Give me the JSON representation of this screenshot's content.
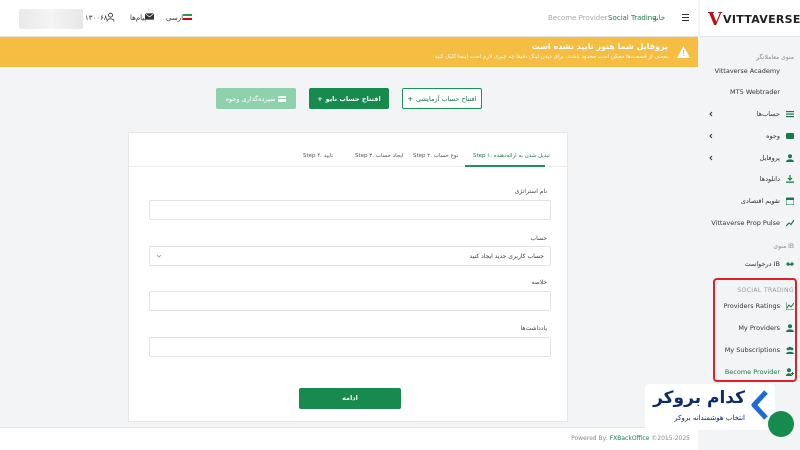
{
  "topbar": {
    "account_number": "۱۳۰۰۶۸",
    "messages_label": "پیام‌ها",
    "language_label": "فارسی",
    "breadcrumb": {
      "home": "خانه",
      "social_trading": "Social Trading",
      "current": "Become Provider"
    }
  },
  "brand": {
    "logo_text": "VITTAVERSE",
    "logo_mark": "V"
  },
  "banner": {
    "title": "پروفایل شما هنوز تایید نشده است",
    "subtitle": "بعضی از قسمت‌ها ممکن است محدود باشند. برای دیدن لینک دقیقا چه چیزی لازم است اینجا کلیک کنید"
  },
  "actions": {
    "demo_account": "افتتاح حساب آزمایشی",
    "real_account": "افتتاح حساب نایو",
    "deposit": "سپرده‌گذاری وجوه"
  },
  "form": {
    "tabs": [
      "Step ۱. تبدیل شدن به ارائه‌دهنده",
      "Step ۲. نوع حساب",
      "Step ۳. ایجاد حساب",
      "Step ۴. تایید"
    ],
    "active_tab": 0,
    "fields": {
      "strategy_name": {
        "label": "نام استراتژی",
        "value": ""
      },
      "account": {
        "label": "حساب",
        "value": "حساب کاربری جدید ایجاد کنید"
      },
      "summary": {
        "label": "خلاصه",
        "value": ""
      },
      "notes": {
        "label": "یادداشت‌ها",
        "value": ""
      }
    },
    "continue_label": "ادامه"
  },
  "sidebar": {
    "main_menu_heading": "منوی معاملاتگر",
    "items": [
      {
        "label": "Vittaverse Academy",
        "icon": "academy-icon",
        "chevron": false
      },
      {
        "label": "MT5 Webtrader",
        "icon": "",
        "chevron": false
      },
      {
        "label": "حساب‌ها",
        "icon": "list-icon",
        "chevron": true
      },
      {
        "label": "وجوه",
        "icon": "wallet-icon",
        "chevron": true
      },
      {
        "label": "پروفایل",
        "icon": "user-icon",
        "chevron": true
      },
      {
        "label": "دانلودها",
        "icon": "download-icon",
        "chevron": false
      },
      {
        "label": "تقویم اقتصادی",
        "icon": "calendar-icon",
        "chevron": false
      },
      {
        "label": "Vittaverse Prop Pulse",
        "icon": "chart-icon",
        "chevron": false
      }
    ],
    "ib_heading": "منوی IB",
    "ib_items": [
      {
        "label": "درخواست IB",
        "icon": "handshake-icon"
      }
    ],
    "social_heading": "SOCIAL TRADING",
    "social_items": [
      {
        "label": "Providers Ratings",
        "icon": "ratings-icon"
      },
      {
        "label": "My Providers",
        "icon": "user-icon"
      },
      {
        "label": "My Subscriptions",
        "icon": "group-icon"
      },
      {
        "label": "Become Provider",
        "icon": "user-plus-icon",
        "active": true
      }
    ]
  },
  "footer": {
    "powered_by": "Powered By:",
    "brand": "FXBackOffice",
    "years": "©2015-2025"
  },
  "watermark": {
    "title": "کدام بروکر",
    "subtitle": "انتخاب هوشمندانه بروکر"
  },
  "colors": {
    "accent": "#178a4e",
    "warning": "#f5bd41",
    "highlight_box": "#e21f26",
    "brand_red": "#b5121b"
  }
}
